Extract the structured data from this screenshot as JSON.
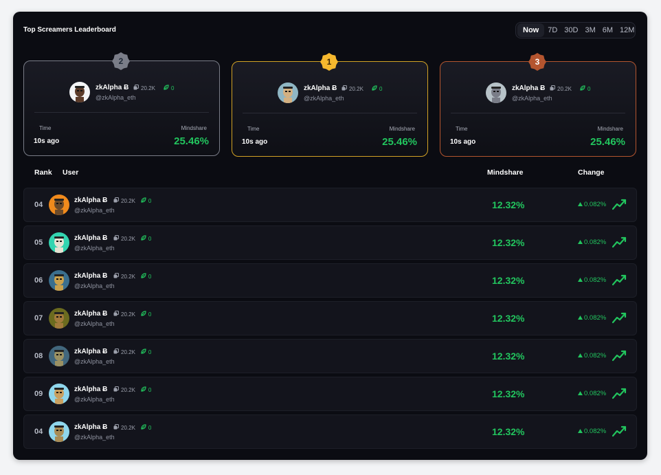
{
  "leaderboard": {
    "title": "Top Screamers Leaderboard",
    "tabs": [
      "Now",
      "7D",
      "30D",
      "3M",
      "6M",
      "12M"
    ],
    "active_tab": "Now"
  },
  "podium": [
    {
      "place": "2",
      "name": "zkAlpha Ƀ",
      "handle": "@zkAlpha_eth",
      "stat_a": "20.2K",
      "stat_b": "0",
      "time_label": "Time",
      "time": "10s ago",
      "mindshare_label": "Mindshare",
      "mindshare": "25.46%"
    },
    {
      "place": "1",
      "name": "zkAlpha Ƀ",
      "handle": "@zkAlpha_eth",
      "stat_a": "20.2K",
      "stat_b": "0",
      "time_label": "Time",
      "time": "10s ago",
      "mindshare_label": "Mindshare",
      "mindshare": "25.46%"
    },
    {
      "place": "3",
      "name": "zkAlpha Ƀ",
      "handle": "@zkAlpha_eth",
      "stat_a": "20.2K",
      "stat_b": "0",
      "time_label": "Time",
      "time": "10s ago",
      "mindshare_label": "Mindshare",
      "mindshare": "25.46%"
    }
  ],
  "table": {
    "headers": {
      "rank": "Rank",
      "user": "User",
      "mindshare": "Mindshare",
      "change": "Change"
    },
    "rows": [
      {
        "rank": "04",
        "name": "zkAlpha Ƀ",
        "handle": "@zkAlpha_eth",
        "stat_a": "20.2K",
        "stat_b": "0",
        "mindshare": "12.32%",
        "change": "0.082%"
      },
      {
        "rank": "05",
        "name": "zkAlpha Ƀ",
        "handle": "@zkAlpha_eth",
        "stat_a": "20.2K",
        "stat_b": "0",
        "mindshare": "12.32%",
        "change": "0.082%"
      },
      {
        "rank": "06",
        "name": "zkAlpha Ƀ",
        "handle": "@zkAlpha_eth",
        "stat_a": "20.2K",
        "stat_b": "0",
        "mindshare": "12.32%",
        "change": "0.082%"
      },
      {
        "rank": "07",
        "name": "zkAlpha Ƀ",
        "handle": "@zkAlpha_eth",
        "stat_a": "20.2K",
        "stat_b": "0",
        "mindshare": "12.32%",
        "change": "0.082%"
      },
      {
        "rank": "08",
        "name": "zkAlpha Ƀ",
        "handle": "@zkAlpha_eth",
        "stat_a": "20.2K",
        "stat_b": "0",
        "mindshare": "12.32%",
        "change": "0.082%"
      },
      {
        "rank": "09",
        "name": "zkAlpha Ƀ",
        "handle": "@zkAlpha_eth",
        "stat_a": "20.2K",
        "stat_b": "0",
        "mindshare": "12.32%",
        "change": "0.082%"
      },
      {
        "rank": "04",
        "name": "zkAlpha Ƀ",
        "handle": "@zkAlpha_eth",
        "stat_a": "20.2K",
        "stat_b": "0",
        "mindshare": "12.32%",
        "change": "0.082%"
      }
    ]
  },
  "icons": {
    "stat_a": "copy-icon",
    "stat_b": "leaf-icon",
    "change_up": "triangle-up-icon",
    "trend": "trend-up-icon"
  },
  "colors": {
    "positive": "#22c55e",
    "silver": "#7a7d88",
    "gold": "#f5b82e",
    "bronze": "#b4552f",
    "panel": "#0b0c12"
  }
}
